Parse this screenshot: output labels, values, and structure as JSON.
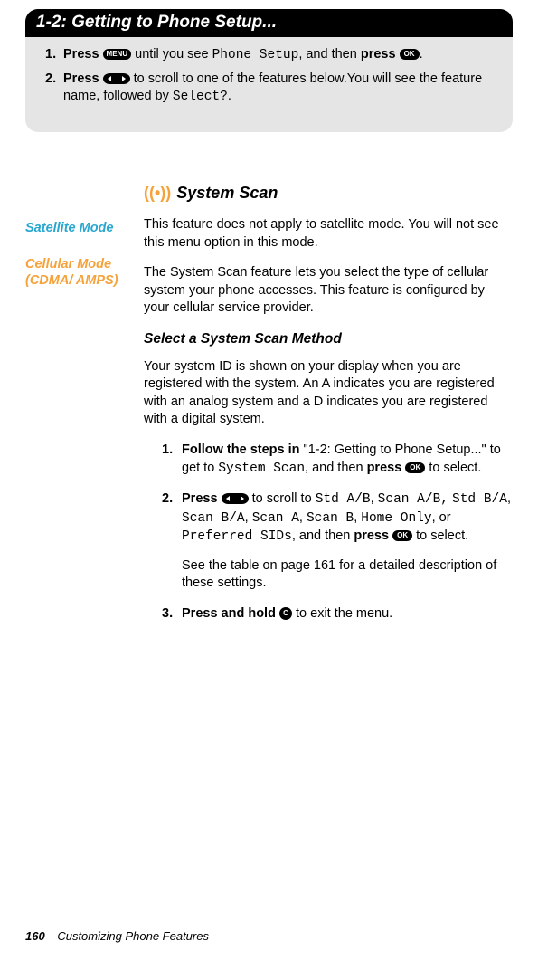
{
  "header": {
    "title": "1-2: Getting to Phone Setup..."
  },
  "greySteps": {
    "s1": {
      "num": "1.",
      "a": "Press",
      "menuBtn": "MENU",
      "b": " until you see ",
      "lcd": "Phone Setup",
      "c": ", and then ",
      "d": "press",
      "okBtn": "OK",
      "e": "."
    },
    "s2": {
      "num": "2.",
      "a": "Press",
      "b": " to scroll to one of the features below.You will see the feature name, followed by ",
      "lcd": "Select?",
      "c": "."
    }
  },
  "sidebar": {
    "sat": "Satellite Mode",
    "cell": "Cellular Mode (CDMA/ AMPS)"
  },
  "main": {
    "sectionTitle": "System Scan",
    "satPara": "This feature does not apply to satellite mode. You will not see this menu option in this mode.",
    "cellPara": "The System Scan feature lets you select the type of cellular system your phone accesses. This feature is configured by your cellular service provider.",
    "subhead": "Select a System Scan Method",
    "intro": "Your system ID is shown on your display when you are registered with the system. An A indicates you are registered with an analog system and a D indicates you are registered with a digital system.",
    "steps": {
      "s1": {
        "num": "1.",
        "bold": "Follow the steps in",
        "a": " \"1-2: Getting to Phone Setup...\" to get to ",
        "lcd": "System Scan",
        "b": ", and then ",
        "bold2": "press",
        "okBtn": "OK",
        "c": " to select."
      },
      "s2": {
        "num": "2.",
        "bold": "Press",
        "a": " to scroll to ",
        "lcd1": "Std A/B",
        "sep1": ", ",
        "lcd2": "Scan A/B,",
        "sep2": " ",
        "lcd3": "Std B/A",
        "sep3": ", ",
        "lcd4": "Scan B/A",
        "sep4": ", ",
        "lcd5": "Scan A",
        "sep5": ", ",
        "lcd6": "Scan B",
        "sep6": ", ",
        "lcd7": "Home Only",
        "sep7": ", or ",
        "lcd8": "Preferred SIDs",
        "b": ", and then ",
        "bold2": "press",
        "okBtn": "OK",
        "c": " to select.",
        "follow": "See the table on page 161 for a detailed description of these settings."
      },
      "s3": {
        "num": "3.",
        "bold": "Press and hold",
        "cBtn": "C",
        "a": " to exit the menu."
      }
    }
  },
  "footer": {
    "page": "160",
    "title": "Customizing Phone Features"
  }
}
